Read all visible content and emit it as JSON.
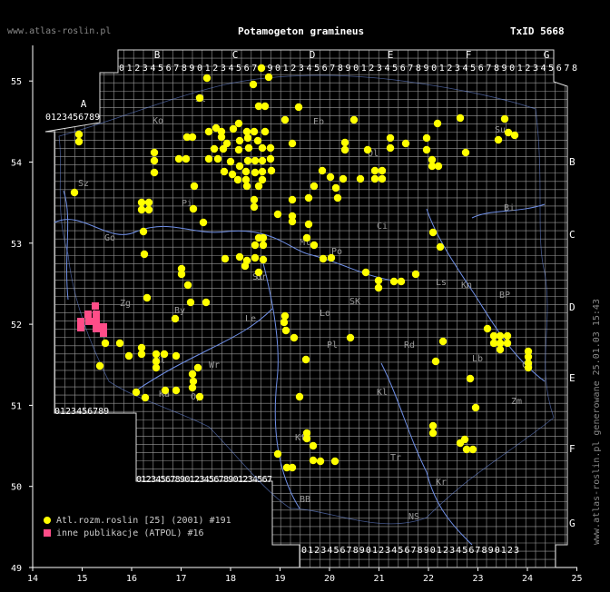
{
  "site": "www.atlas-roslin.pl",
  "title": "Potamogeton gramineus",
  "taxid": "TxID 5668",
  "generated": "www.atlas-roslin.pl generowane 25.01.03 15:43",
  "colors": {
    "background": "#000000",
    "grid": "#9a9a9a",
    "record_atlas": "#ffff00",
    "record_other": "#ff4d88",
    "river": "#6f8fe6",
    "axis": "#ffffff"
  },
  "axes": {
    "lon_ticks": [
      "14",
      "15",
      "16",
      "17",
      "18",
      "19",
      "20",
      "21",
      "22",
      "23",
      "24",
      "25"
    ],
    "lat_ticks": [
      "49",
      "50",
      "51",
      "52",
      "53",
      "54",
      "55"
    ]
  },
  "atpol_columns": [
    "A",
    "B",
    "C",
    "D",
    "E",
    "F",
    "G"
  ],
  "atpol_rows": [
    "B",
    "C",
    "D",
    "E",
    "F",
    "G"
  ],
  "digits_top": "0123456789",
  "region_labels": [
    "Sl",
    "Ko",
    "Eb",
    "Ol",
    "Su",
    "Sz",
    "Pi",
    "Ci",
    "Bi",
    "Go",
    "Gr",
    "Ml",
    "Po",
    "Zg",
    "By",
    "Le",
    "Lo",
    "SK",
    "BP",
    "Kn",
    "Pl",
    "Rd",
    "Lb",
    "Ch",
    "Wl",
    "Wr",
    "Op",
    "Kt",
    "Kl",
    "Zm",
    "Ka",
    "Tr",
    "NS",
    "Kr",
    "BB",
    "Ls",
    "Sl"
  ],
  "legend": [
    {
      "label": "Atl.rozm.roslin [25] (2001) #191",
      "color": "#ffff00",
      "shape": "circle"
    },
    {
      "label": "inne publikacje (ATPOL) #16",
      "color": "#ff4d88",
      "shape": "square"
    }
  ]
}
